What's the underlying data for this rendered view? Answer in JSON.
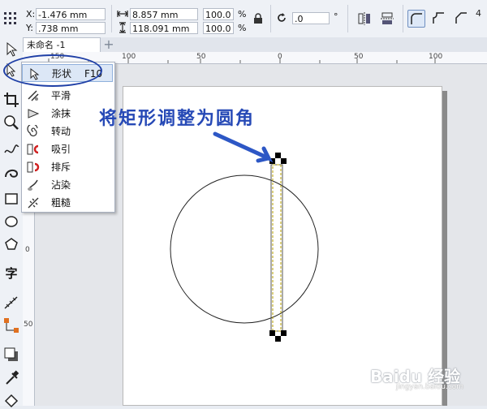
{
  "propbar": {
    "x_label": "X:",
    "x_value": "-1.476 mm",
    "y_label": "Y:",
    "y_value": ".738 mm",
    "width_value": "8.857 mm",
    "height_value": "118.091 mm",
    "scale_w_value": "100.0",
    "scale_h_value": "100.0",
    "percent_symbol": "%",
    "rotation_value": ".0",
    "degree_symbol": "°"
  },
  "document": {
    "tab_label": "未命名 -1",
    "tab_add": "+"
  },
  "rulers": {
    "h_ticks": [
      "150",
      "100",
      "50",
      "0",
      "50",
      "100"
    ],
    "v_ticks": [
      "0",
      "50"
    ]
  },
  "flyout": {
    "items": [
      {
        "label": "形状",
        "shortcut": "F10",
        "icon": "shape-icon"
      },
      {
        "label": "平滑",
        "icon": "smooth-icon"
      },
      {
        "label": "涂抹",
        "icon": "smear-icon"
      },
      {
        "label": "转动",
        "icon": "twirl-icon"
      },
      {
        "label": "吸引",
        "icon": "attract-icon"
      },
      {
        "label": "排斥",
        "icon": "repel-icon"
      },
      {
        "label": "沾染",
        "icon": "smudge-icon"
      },
      {
        "label": "粗糙",
        "icon": "roughen-icon"
      }
    ]
  },
  "annotation": {
    "text": "将矩形调整为圆角",
    "color": "#2649b6"
  },
  "watermark": {
    "text": "Baidu 经验",
    "sub": "jingyan.baidu.com"
  },
  "colors": {
    "accent": "#2649b6",
    "selection_handle": "#000000",
    "guide_dash": "#b8a000"
  }
}
